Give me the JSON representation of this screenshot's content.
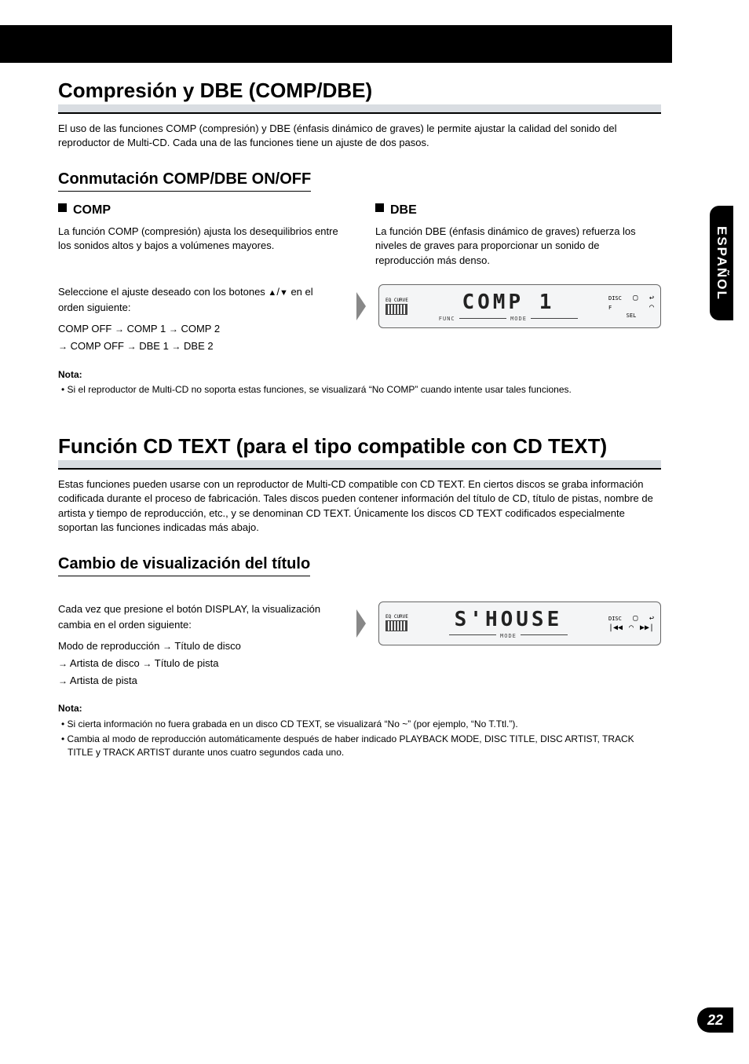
{
  "sideTab": "ESPAÑOL",
  "pageNumber": "22",
  "section1": {
    "title": "Compresión y DBE (COMP/DBE)",
    "intro": "El uso de las funciones COMP (compresión) y DBE (énfasis dinámico de graves) le permite ajustar la calidad del sonido del reproductor de Multi-CD. Cada una de las funciones tiene un ajuste de dos pasos.",
    "sub": "Conmutación COMP/DBE ON/OFF",
    "comp": {
      "label": "COMP",
      "text": "La función COMP (compresión) ajusta los desequilibrios entre los sonidos altos y bajos a volúmenes mayores."
    },
    "dbe": {
      "label": "DBE",
      "text": "La función DBE (énfasis dinámico de graves) refuerza los niveles de graves para proporcionar un sonido de reproducción más denso."
    },
    "step": {
      "line1": "Seleccione el ajuste deseado con los botones ",
      "tri": "5/∞",
      "line2": " en el orden siguiente:",
      "cycle": "COMP OFF → COMP 1 → COMP 2 → COMP OFF → DBE 1 → DBE 2",
      "lcd_main": "COMP  1",
      "lcd_eq": "EQ CURVE",
      "lcd_func": "FUNC",
      "lcd_mode": "MODE",
      "lcd_disc": "DISC",
      "lcd_f": "F",
      "lcd_sel": "SEL"
    },
    "note": {
      "title": "Nota:",
      "item": "Si el reproductor de Multi-CD no soporta estas funciones, se visualizará “No COMP” cuando intente usar tales funciones."
    }
  },
  "section2": {
    "title": "Función CD TEXT (para el tipo compatible con CD TEXT)",
    "intro": "Estas funciones pueden usarse con un reproductor de Multi-CD compatible con CD TEXT. En ciertos discos se graba información codificada durante el proceso de fabricación. Tales discos pueden contener información del título de CD, título de pistas, nombre de artista y tiempo de reproducción, etc., y se denominan CD TEXT. Únicamente los discos CD TEXT codificados especialmente soportan las funciones indicadas más abajo.",
    "sub": "Cambio de visualización del título",
    "step": {
      "text": "Cada vez que presione el botón DISPLAY, la visualización cambia en el orden siguiente:",
      "cycle": "Modo de reproducción → Título de disco → Artista de disco → Título de pista → Artista de pista",
      "lcd_main": "S'HOUSE",
      "lcd_eq": "EQ CURVE",
      "lcd_mode": "MODE",
      "lcd_disc": "DISC",
      "lcd_prev": "|◀◀",
      "lcd_next": "▶▶|"
    },
    "note": {
      "title": "Nota:",
      "item1": "Si cierta información no fuera grabada en un disco CD TEXT, se visualizará “No ~” (por ejemplo, “No T.Ttl.”).",
      "item2": "Cambia al modo de reproducción automáticamente después de haber indicado PLAYBACK MODE, DISC TITLE, DISC ARTIST, TRACK TITLE y TRACK ARTIST durante unos cuatro segundos cada uno."
    }
  }
}
